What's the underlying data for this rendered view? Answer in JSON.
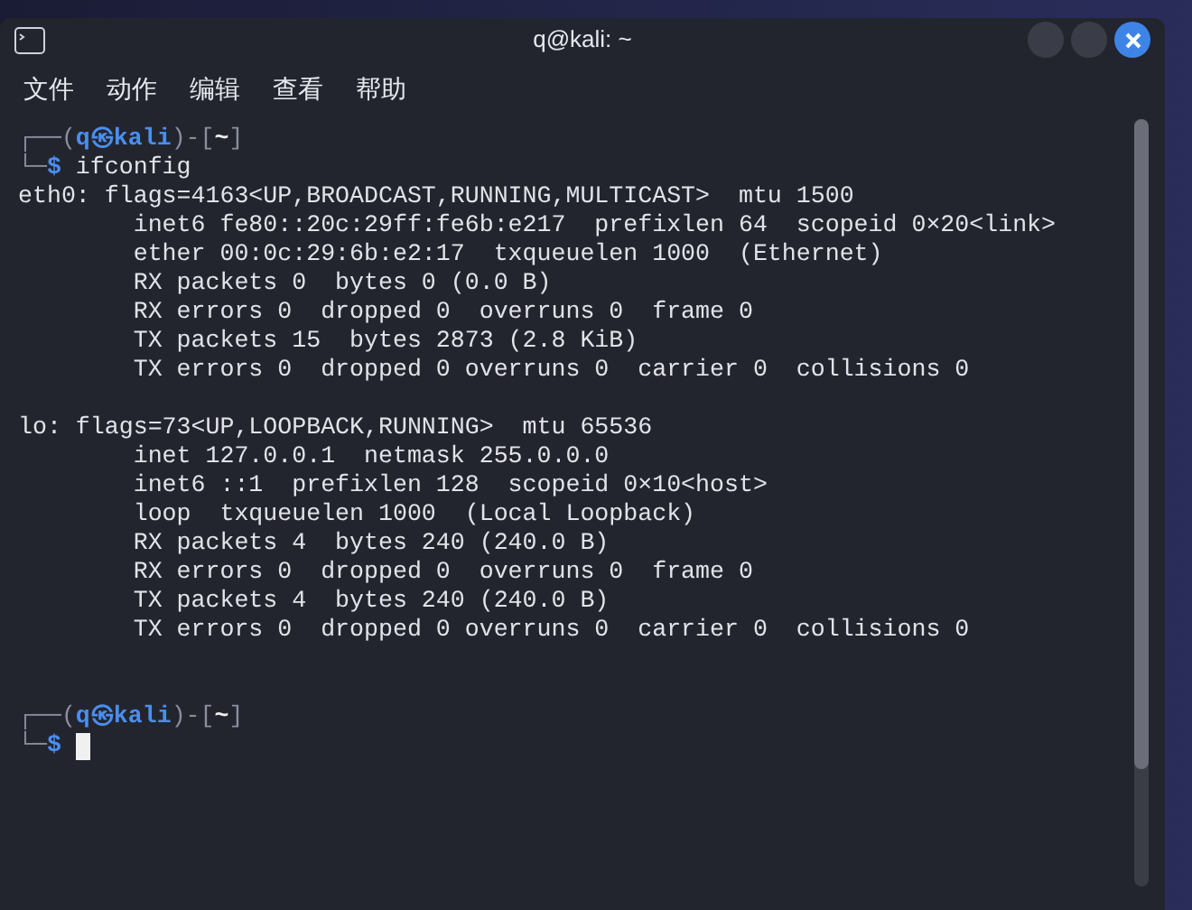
{
  "window": {
    "title": "q@kali: ~"
  },
  "menu": [
    "文件",
    "动作",
    "编辑",
    "查看",
    "帮助"
  ],
  "terminal": [
    {
      "kind": "prompt",
      "frame_open": "┌──(",
      "user_host": "q㉿kali",
      "sep": ")-[",
      "path": "~",
      "frame_close": "]"
    },
    {
      "kind": "command",
      "corner": "└─",
      "symbol": "$",
      "command": "ifconfig"
    },
    {
      "kind": "output",
      "text": "eth0: flags=4163<UP,BROADCAST,RUNNING,MULTICAST>  mtu 1500"
    },
    {
      "kind": "output",
      "text": "        inet6 fe80::20c:29ff:fe6b:e217  prefixlen 64  scopeid 0×20<link>"
    },
    {
      "kind": "output",
      "text": "        ether 00:0c:29:6b:e2:17  txqueuelen 1000  (Ethernet)"
    },
    {
      "kind": "output",
      "text": "        RX packets 0  bytes 0 (0.0 B)"
    },
    {
      "kind": "output",
      "text": "        RX errors 0  dropped 0  overruns 0  frame 0"
    },
    {
      "kind": "output",
      "text": "        TX packets 15  bytes 2873 (2.8 KiB)"
    },
    {
      "kind": "output",
      "text": "        TX errors 0  dropped 0 overruns 0  carrier 0  collisions 0"
    },
    {
      "kind": "blank"
    },
    {
      "kind": "output",
      "text": "lo: flags=73<UP,LOOPBACK,RUNNING>  mtu 65536"
    },
    {
      "kind": "output",
      "text": "        inet 127.0.0.1  netmask 255.0.0.0"
    },
    {
      "kind": "output",
      "text": "        inet6 ::1  prefixlen 128  scopeid 0×10<host>"
    },
    {
      "kind": "output",
      "text": "        loop  txqueuelen 1000  (Local Loopback)"
    },
    {
      "kind": "output",
      "text": "        RX packets 4  bytes 240 (240.0 B)"
    },
    {
      "kind": "output",
      "text": "        RX errors 0  dropped 0  overruns 0  frame 0"
    },
    {
      "kind": "output",
      "text": "        TX packets 4  bytes 240 (240.0 B)"
    },
    {
      "kind": "output",
      "text": "        TX errors 0  dropped 0 overruns 0  carrier 0  collisions 0"
    },
    {
      "kind": "blank"
    },
    {
      "kind": "blank"
    },
    {
      "kind": "prompt",
      "frame_open": "┌──(",
      "user_host": "q㉿kali",
      "sep": ")-[",
      "path": "~",
      "frame_close": "]"
    },
    {
      "kind": "command",
      "corner": "└─",
      "symbol": "$",
      "cursor": true
    }
  ]
}
